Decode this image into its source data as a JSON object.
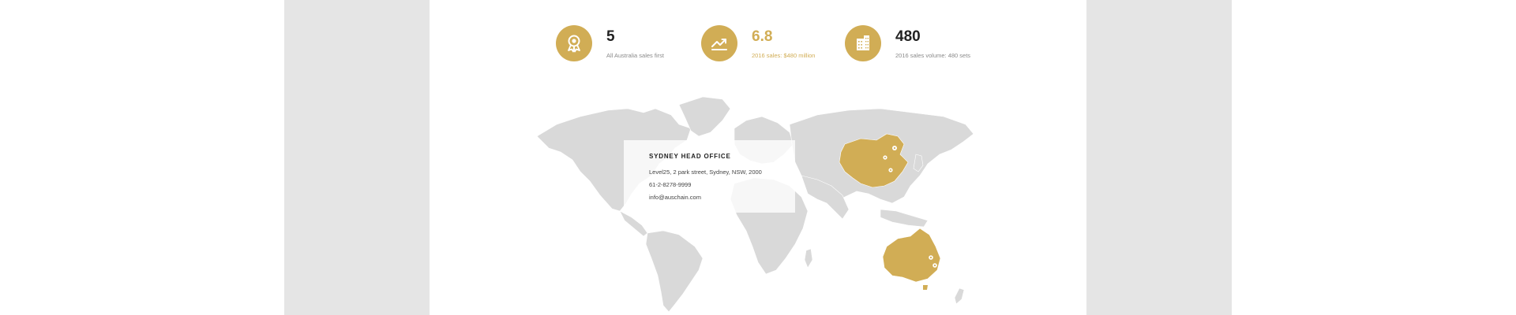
{
  "colors": {
    "accent": "#d1ad55",
    "map_land": "#d9d9d9",
    "side_band": "#e5e5e5"
  },
  "stats": [
    {
      "icon": "award-medal-icon",
      "value": "5",
      "caption": "All Australia sales first"
    },
    {
      "icon": "trend-up-icon",
      "value": "6.8",
      "caption": "2016 sales: $480 million"
    },
    {
      "icon": "buildings-icon",
      "value": "480",
      "caption": "2016 sales volume: 480 sets"
    }
  ],
  "office": {
    "title": "SYDNEY HEAD OFFICE",
    "address": "Level25, 2 park street, Sydney, NSW, 2000",
    "phone": "61-2-8278-9999",
    "email": "info@auschain.com"
  },
  "map": {
    "highlighted_regions": [
      "China",
      "Australia"
    ],
    "marker_icon": "map-pin-icon"
  }
}
